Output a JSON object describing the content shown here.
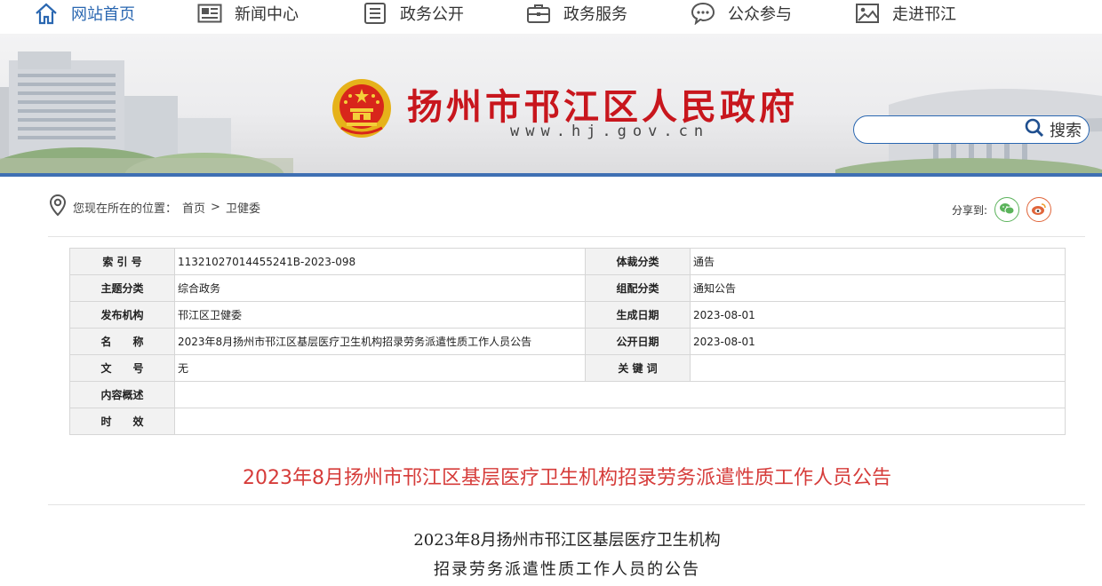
{
  "nav": {
    "items": [
      {
        "label": "网站首页",
        "icon": "home-icon"
      },
      {
        "label": "新闻中心",
        "icon": "newspaper-icon"
      },
      {
        "label": "政务公开",
        "icon": "list-document-icon"
      },
      {
        "label": "政务服务",
        "icon": "briefcase-icon"
      },
      {
        "label": "公众参与",
        "icon": "chat-bubble-icon"
      },
      {
        "label": "走进邗江",
        "icon": "picture-icon"
      }
    ]
  },
  "banner": {
    "title": "扬州市邗江区人民政府",
    "url": "www.hj.gov.cn",
    "search_label": "搜索",
    "search_placeholder": ""
  },
  "breadcrumb": {
    "prefix": "您现在所在的位置：",
    "home": "首页",
    "separator": ">",
    "current": "卫健委"
  },
  "share": {
    "label": "分享到:",
    "targets": [
      "wechat-icon",
      "weibo-icon"
    ]
  },
  "meta": {
    "index_label": "索 引 号",
    "index_value": "11321027014455241B-2023-098",
    "genre_label": "体裁分类",
    "genre_value": "通告",
    "topic_label": "主题分类",
    "topic_value": "综合政务",
    "group_label": "组配分类",
    "group_value": "通知公告",
    "publisher_label": "发布机构",
    "publisher_value": "邗江区卫健委",
    "created_label": "生成日期",
    "created_value": "2023-08-01",
    "name_label": "名　　称",
    "name_value": "2023年8月扬州市邗江区基层医疗卫生机构招录劳务派遣性质工作人员公告",
    "public_label": "公开日期",
    "public_value": "2023-08-01",
    "docno_label": "文　　号",
    "docno_value": "无",
    "keywords_label": "关 键 词",
    "keywords_value": "",
    "summary_label": "内容概述",
    "summary_value": "",
    "validity_label": "时　　效",
    "validity_value": ""
  },
  "article": {
    "title": "2023年8月扬州市邗江区基层医疗卫生机构招录劳务派遣性质工作人员公告",
    "subtitle_line1": "2023年8月扬州市邗江区基层医疗卫生机构",
    "subtitle_line2": "招录劳务派遣性质工作人员的公告"
  },
  "colors": {
    "brand_blue": "#2a67b1",
    "title_red": "#c8161d",
    "article_title_red": "#d63c3a"
  }
}
